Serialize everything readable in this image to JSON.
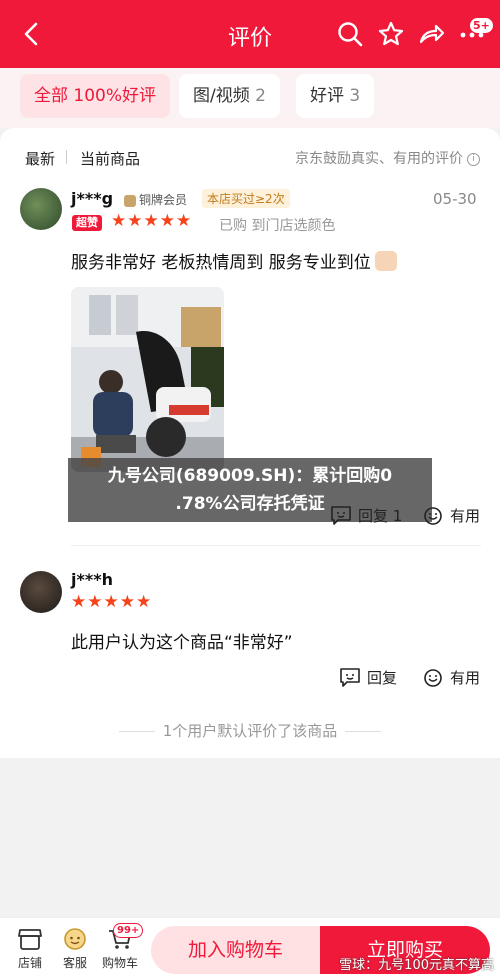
{
  "header": {
    "title": "评价",
    "badge": "5+"
  },
  "filters": [
    {
      "label": "全部 100%好评",
      "count": ""
    },
    {
      "label": "图/视频",
      "count": "2"
    },
    {
      "label": "好评",
      "count": "3"
    }
  ],
  "sort": {
    "latest": "最新",
    "current": "当前商品",
    "notice": "京东鼓励真实、有用的评价"
  },
  "reviews": [
    {
      "user": "j***g",
      "member": "铜牌会员",
      "rebuy": "本店买过≥2次",
      "date": "05-30",
      "super_tag": "超赞",
      "stars": "★★★★★",
      "bought": "已购 到门店选颜色",
      "text": "服务非常好 老板热情周到 服务专业到位",
      "reply": "回复 1",
      "useful": "有用"
    },
    {
      "user": "j***h",
      "stars": "★★★★★",
      "text": "此用户认为这个商品“非常好”",
      "reply": "回复",
      "useful": "有用"
    }
  ],
  "overlay": {
    "line1": "九号公司(689009.SH)：累计回购0",
    "line2": ".78%公司存托凭证"
  },
  "footnote": "1个用户默认评价了该商品",
  "bottom": {
    "store": "店铺",
    "service": "客服",
    "cart": "购物车",
    "cart_badge": "99+",
    "add_cart": "加入购物车",
    "buy_now": "立即购买",
    "watermark": "雪球：九号100元真不算高"
  }
}
